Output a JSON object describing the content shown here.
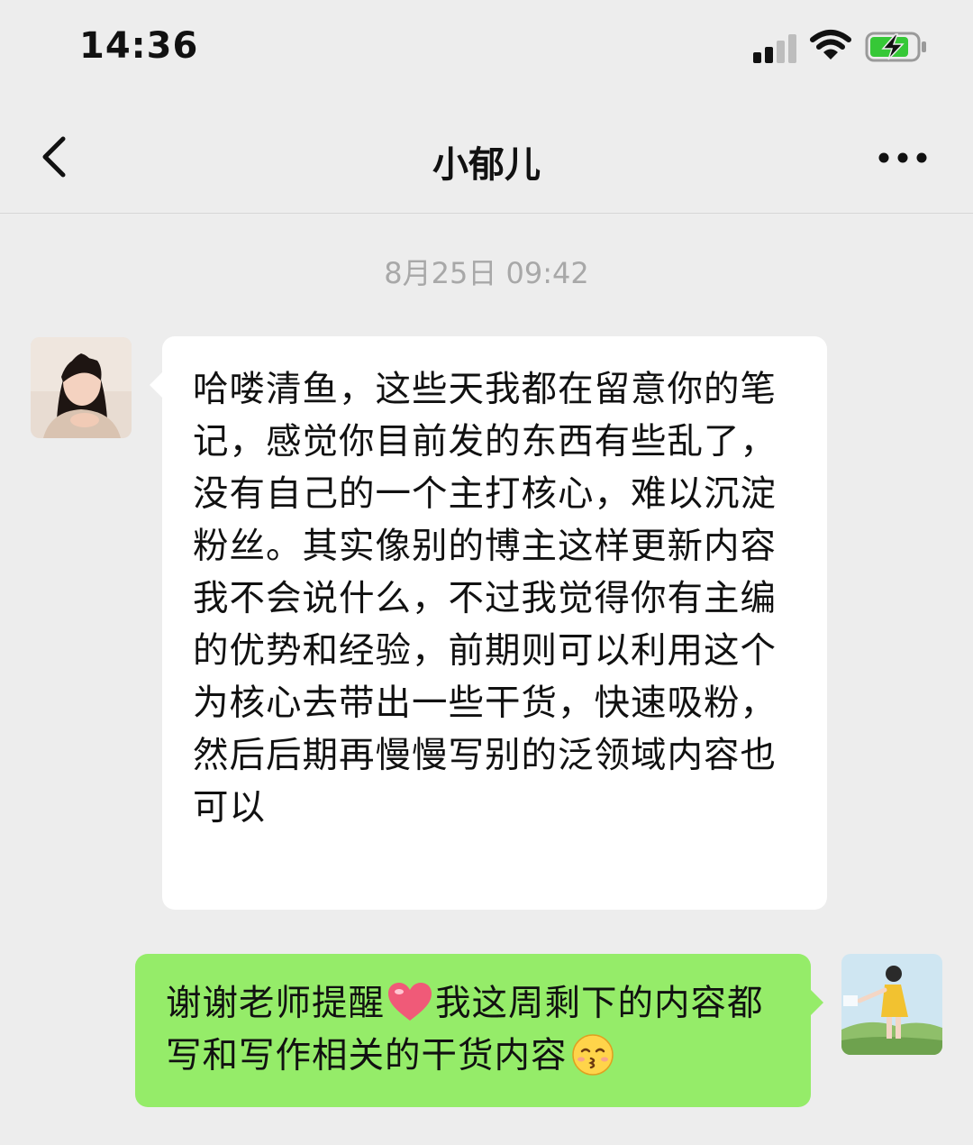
{
  "status_bar": {
    "time": "14:36",
    "signal_icon": "cellular-signal-icon",
    "wifi_icon": "wifi-icon",
    "battery_icon": "battery-charging-icon"
  },
  "nav": {
    "back_icon": "chevron-left-icon",
    "title": "小郁儿",
    "more_icon": "more-dots-icon"
  },
  "chat": {
    "timestamp": "8月25日 09:42",
    "messages": [
      {
        "sender": "contact",
        "text": "哈喽清鱼，这些天我都在留意你的笔记，感觉你目前发的东西有些乱了，没有自己的一个主打核心，难以沉淀粉丝。其实像别的博主这样更新内容我不会说什么，不过我觉得你有主编的优势和经验，前期则可以利用这个为核心去带出一些干货，快速吸粉，然后后期再慢慢写别的泛领域内容也可以"
      },
      {
        "sender": "me",
        "text_part1": "谢谢老师提醒",
        "emoji1": "heart-emoji",
        "text_part2": "我这周剩下的内容都写和写作相关的干货内容",
        "emoji2": "kissing-smiling-eyes-emoji"
      }
    ]
  },
  "colors": {
    "background": "#ededed",
    "incoming_bubble": "#ffffff",
    "outgoing_bubble": "#95ec69",
    "timestamp": "#a8a8a8"
  }
}
